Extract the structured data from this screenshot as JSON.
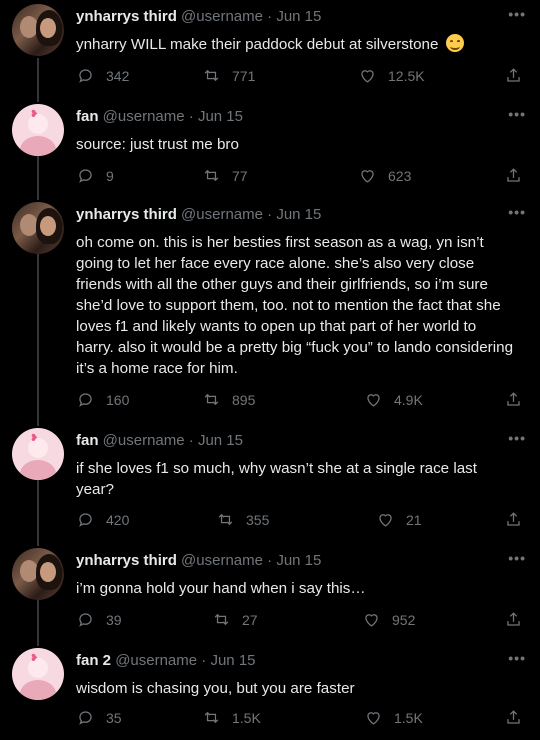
{
  "tweets": [
    {
      "name": "ynharrys third",
      "handle": "@username",
      "sep": "·",
      "date": "Jun 15",
      "text": "ynharry WILL make their paddock debut at silverstone",
      "emoji": "relieved-face",
      "replies": "342",
      "retweets": "771",
      "likes": "12.5K",
      "avatar": "couple-photo"
    },
    {
      "name": "fan",
      "handle": "@username",
      "sep": "·",
      "date": "Jun 15",
      "text": "source: just trust me bro",
      "replies": "9",
      "retweets": "77",
      "likes": "623",
      "avatar": "pink-default"
    },
    {
      "name": "ynharrys third",
      "handle": "@username",
      "sep": "·",
      "date": "Jun 15",
      "text": "oh come on. this is her besties first season as a wag, yn isn’t going to let her face every race alone. she’s also very close friends with all the other guys and their girlfriends, so i’m sure she’d love to support them, too. not to mention the fact that she loves f1 and likely wants to open up that part of her world to harry. also it would be a pretty big “fuck you” to lando considering it’s a home race for him.",
      "replies": "160",
      "retweets": "895",
      "likes": "4.9K",
      "avatar": "couple-photo"
    },
    {
      "name": "fan",
      "handle": "@username",
      "sep": "·",
      "date": "Jun 15",
      "text": "if she loves f1 so much, why wasn’t she at a single race last year?",
      "replies": "420",
      "retweets": "355",
      "likes": "21",
      "avatar": "pink-default"
    },
    {
      "name": "ynharrys third",
      "handle": "@username",
      "sep": "·",
      "date": "Jun 15",
      "text": "i’m gonna hold your hand when i say this…",
      "replies": "39",
      "retweets": "27",
      "likes": "952",
      "avatar": "couple-photo"
    },
    {
      "name": "fan 2",
      "handle": "@username",
      "sep": "·",
      "date": "Jun 15",
      "text": "wisdom is chasing you, but you are faster",
      "replies": "35",
      "retweets": "1.5K",
      "likes": "1.5K",
      "avatar": "pink-default"
    }
  ],
  "more_label": "•••",
  "icons": {
    "reply": "reply-icon",
    "retweet": "retweet-icon",
    "like": "heart-icon",
    "share": "share-icon"
  },
  "colors": {
    "background": "#000000",
    "text": "#e7e9ea",
    "muted": "#71767b",
    "thread_line": "#333639"
  }
}
